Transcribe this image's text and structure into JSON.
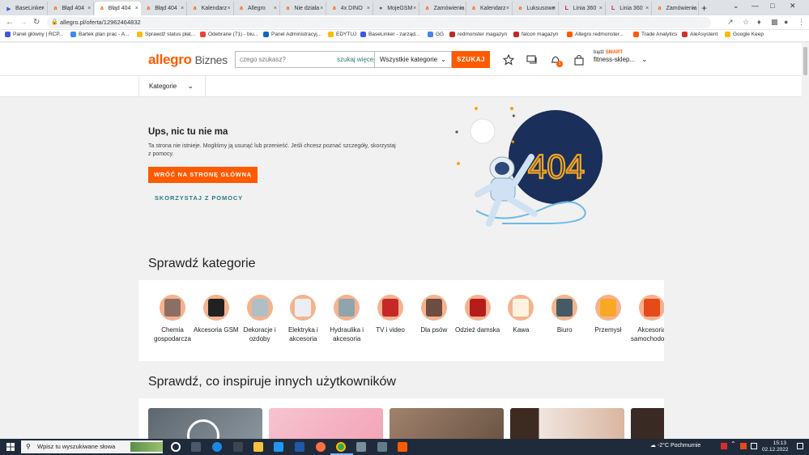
{
  "browser": {
    "tabs": [
      {
        "title": "BaseLinker",
        "favicon": "baselinker-icon",
        "color": "#3b5bdb",
        "glyph": "▶"
      },
      {
        "title": "Błąd 404",
        "favicon": "allegro-icon",
        "color": "#ff5a00",
        "glyph": "a"
      },
      {
        "title": "Błąd 404",
        "favicon": "allegro-icon",
        "color": "#ff5a00",
        "glyph": "a",
        "active": true
      },
      {
        "title": "Błąd 404",
        "favicon": "allegro-icon",
        "color": "#ff5a00",
        "glyph": "a"
      },
      {
        "title": "Kalendarz",
        "favicon": "allegro-icon",
        "color": "#ff5a00",
        "glyph": "a"
      },
      {
        "title": "Allegro",
        "favicon": "allegro-icon",
        "color": "#ff5a00",
        "glyph": "a"
      },
      {
        "title": "Nie działa",
        "favicon": "allegro-icon",
        "color": "#ff5a00",
        "glyph": "a"
      },
      {
        "title": "4x DINO",
        "favicon": "allegro-icon",
        "color": "#ff5a00",
        "glyph": "a"
      },
      {
        "title": "MojeGSM",
        "favicon": "globe-icon",
        "color": "#5f6368",
        "glyph": "●"
      },
      {
        "title": "Zamówienia",
        "favicon": "allegro-icon",
        "color": "#ff5a00",
        "glyph": "a"
      },
      {
        "title": "Kalendarz",
        "favicon": "allegro-icon",
        "color": "#ff5a00",
        "glyph": "a"
      },
      {
        "title": "Luksusowe",
        "favicon": "allegro-icon",
        "color": "#ff5a00",
        "glyph": "a"
      },
      {
        "title": "Linia 360",
        "favicon": "linia-icon",
        "color": "#c2185b",
        "glyph": "L"
      },
      {
        "title": "Linia 360",
        "favicon": "linia-icon",
        "color": "#c2185b",
        "glyph": "L"
      },
      {
        "title": "Zamówienia",
        "favicon": "allegro-icon",
        "color": "#ff5a00",
        "glyph": "a"
      }
    ],
    "url": "allegro.pl/oferta/12962464832",
    "bookmarks": [
      {
        "label": "Panel główny | RCP...",
        "color": "#3b5bdb"
      },
      {
        "label": "Bartek plan prac - A...",
        "color": "#4285f4"
      },
      {
        "label": "Sprawdź status płat...",
        "color": "#fbbc05"
      },
      {
        "label": "Odebrane (71) - biu...",
        "color": "#ea4335"
      },
      {
        "label": "Panel Administracyj...",
        "color": "#1565c0"
      },
      {
        "label": "EDYTUJ",
        "color": "#fbbc05"
      },
      {
        "label": "BaseLinker - zarząd...",
        "color": "#3b5bdb"
      },
      {
        "label": "GG",
        "color": "#4285f4"
      },
      {
        "label": "redmonster magazyn",
        "color": "#c62828"
      },
      {
        "label": "falcon magazyn",
        "color": "#c62828"
      },
      {
        "label": "Allegro redmonster...",
        "color": "#ff5a00"
      },
      {
        "label": "Trade Analytics",
        "color": "#ff5a00"
      },
      {
        "label": "AleAsystent",
        "color": "#d32f2f"
      },
      {
        "label": "Google Keep",
        "color": "#fbbc05"
      }
    ]
  },
  "header": {
    "logo": "allegro",
    "logo_suffix": "Biznes",
    "search_placeholder": "czego szukasz?",
    "search_deep": "szukaj więcej",
    "category_select": "Wszystkie kategorie",
    "search_button": "SZUKAJ",
    "smart_prefix": "bądź",
    "smart_label": "SMART",
    "account_name": "fitness-sklep...",
    "notification_count": "1"
  },
  "catnav": {
    "label": "Kategorie"
  },
  "error": {
    "title": "Ups, nic tu nie ma",
    "text": "Ta strona nie istnieje. Mogliśmy ją usunąć lub przenieść. Jeśli chcesz poznać szczegóły, skorzystaj z pomocy.",
    "home_button": "WRÓĆ NA STRONĘ GŁÓWNĄ",
    "help_link": "SKORZYSTAJ Z POMOCY",
    "illustration_text": "404"
  },
  "categories": {
    "title": "Sprawdź kategorie",
    "items": [
      {
        "label": "Chemia gospodarcza",
        "color": "#8d6e63"
      },
      {
        "label": "Akcesoria GSM",
        "color": "#212121"
      },
      {
        "label": "Dekoracje i ozdoby",
        "color": "#b0bec5"
      },
      {
        "label": "Elektryka i akcesoria",
        "color": "#eceff1"
      },
      {
        "label": "Hydraulika i akcesoria",
        "color": "#90a4ae"
      },
      {
        "label": "TV i video",
        "color": "#c62828"
      },
      {
        "label": "Dla psów",
        "color": "#6d4c41"
      },
      {
        "label": "Odzież damska",
        "color": "#b71c1c"
      },
      {
        "label": "Kawa",
        "color": "#fff3e0"
      },
      {
        "label": "Biuro",
        "color": "#455a64"
      },
      {
        "label": "Przemysł",
        "color": "#f9a825"
      },
      {
        "label": "Akcesoria samochodowe",
        "color": "#e64a19"
      }
    ]
  },
  "inspiration": {
    "title": "Sprawdź, co inspiruje innych użytkowników"
  },
  "taskbar": {
    "search_placeholder": "Wpisz tu wyszukiwane słowa",
    "weather": "-2°C  Pochmurnie",
    "time": "15:13",
    "date": "02.12.2022"
  }
}
